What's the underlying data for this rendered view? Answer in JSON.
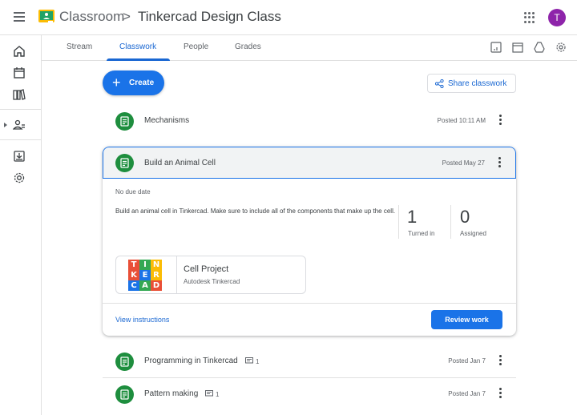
{
  "header": {
    "app_title": "Classroom",
    "separator": ">",
    "class_title": "Tinkercad Design Class",
    "avatar_initial": "T"
  },
  "tabs": [
    {
      "label": "Stream"
    },
    {
      "label": "Classwork"
    },
    {
      "label": "People"
    },
    {
      "label": "Grades"
    }
  ],
  "toolbar": {
    "create_label": "Create",
    "share_label": "Share classwork"
  },
  "items": [
    {
      "title": "Mechanisms",
      "posted": "Posted 10:11 AM"
    },
    {
      "title": "Build an Animal Cell",
      "posted": "Posted May 27"
    },
    {
      "title": "Programming in Tinkercad",
      "comments": "1",
      "posted": "Posted Jan 7"
    },
    {
      "title": "Pattern making",
      "comments": "1",
      "posted": "Posted Jan 7"
    }
  ],
  "expanded": {
    "due": "No due date",
    "description": "Build an animal cell in Tinkercad. Make sure to include all of the components that make up the cell.",
    "turned_in_count": "1",
    "turned_in_label": "Turned in",
    "assigned_count": "0",
    "assigned_label": "Assigned",
    "attachment": {
      "title": "Cell Project",
      "subtitle": "Autodesk Tinkercad",
      "logo_letters": [
        "T",
        "I",
        "N",
        "K",
        "E",
        "R",
        "C",
        "A",
        "D"
      ]
    },
    "view_label": "View instructions",
    "review_label": "Review work"
  },
  "colors": {
    "accent": "#1a73e8",
    "assignment_green": "#1e8e3e",
    "avatar": "#8e24aa",
    "logo_letter_colors": [
      "#e94f37",
      "#34a853",
      "#fbbc05",
      "#e94f37",
      "#1a73e8",
      "#fbbc05",
      "#1a73e8",
      "#34a853",
      "#e94f37"
    ]
  }
}
